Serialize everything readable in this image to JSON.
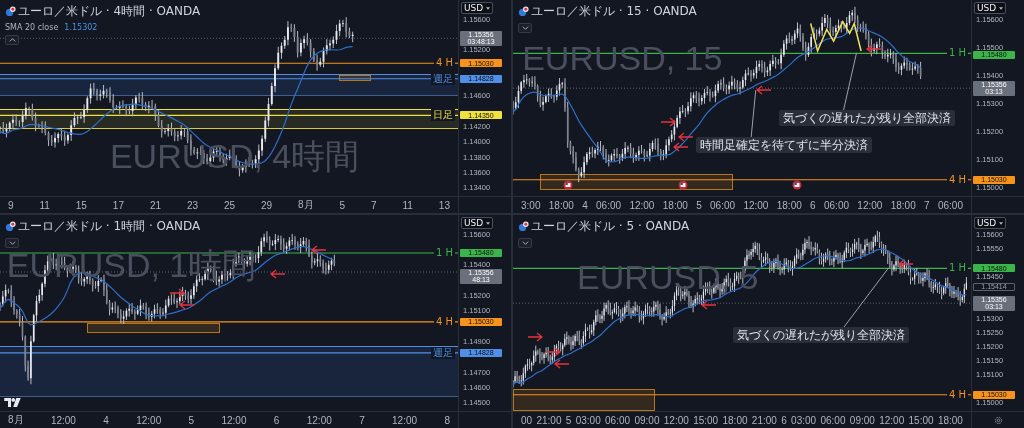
{
  "panels": [
    {
      "title": "ユーロ／米ドル · 4時間 · OANDA",
      "currency": "USD",
      "legend_expanded": true,
      "legend": {
        "name": "SMA 20 close",
        "value": "1.15302"
      },
      "watermark": "EURUSD, 4時間",
      "price_ticks": [
        "1.15600",
        "1.15200",
        "1.14600",
        "1.14200",
        "1.14000",
        "1.13800",
        "1.13600",
        "1.13400"
      ],
      "levels": [
        {
          "kind": "last",
          "price": "1.15356",
          "countdown": "03:48:13"
        },
        {
          "kind": "level",
          "label": "4 H",
          "price": "1.15030",
          "color": "#f7931a"
        },
        {
          "kind": "level",
          "label": "週足",
          "price": "1.14828",
          "color": "#4f8fe8"
        },
        {
          "kind": "level",
          "label": "日足",
          "price": "1.14350",
          "color": "#f0e040"
        }
      ],
      "time_ticks": [
        "9",
        "11",
        "15",
        "17",
        "21",
        "23",
        "25",
        "29",
        "8月",
        "5",
        "7",
        "11",
        "13"
      ]
    },
    {
      "title": "ユーロ／米ドル · 15 · OANDA",
      "currency": "USD",
      "legend_expanded": false,
      "watermark": "EURUSD, 15",
      "price_ticks": [
        "1.15600",
        "1.15500",
        "1.15400",
        "1.15300",
        "1.15200",
        "1.15100",
        "1.15000"
      ],
      "levels": [
        {
          "kind": "level",
          "label": "1 H",
          "price": "1.15480",
          "color": "#3bb54a"
        },
        {
          "kind": "last",
          "price": "1.15356",
          "countdown": "03:13"
        },
        {
          "kind": "level",
          "label": "4 H",
          "price": "1.15030",
          "color": "#f7931a"
        }
      ],
      "callouts": [
        "時間足確定を待てずに半分決済",
        "気づくの遅れたが残り全部決済"
      ],
      "time_ticks": [
        "3:00",
        "18:00",
        "4",
        "06:00",
        "12:00",
        "18:00",
        "5",
        "06:00",
        "12:00",
        "18:00",
        "6",
        "06:00",
        "12:00",
        "18:00",
        "7",
        "06:00"
      ]
    },
    {
      "title": "ユーロ／米ドル · 1時間 · OANDA",
      "currency": "USD",
      "legend_expanded": false,
      "watermark": "EURUSD, 1時間",
      "logo": true,
      "price_ticks": [
        "1.15600",
        "1.15400",
        "1.15200",
        "1.15100",
        "1.14900",
        "1.14700",
        "1.14600",
        "1.14500"
      ],
      "levels": [
        {
          "kind": "level",
          "label": "1 H",
          "price": "1.15480",
          "color": "#3bb54a"
        },
        {
          "kind": "last",
          "price": "1.15356",
          "countdown": "48:13"
        },
        {
          "kind": "level",
          "label": "4 H",
          "price": "1.15030",
          "color": "#f7931a"
        },
        {
          "kind": "level",
          "label": "週足",
          "price": "1.14828",
          "color": "#4f8fe8"
        }
      ],
      "time_ticks": [
        "8月",
        "12:00",
        "4",
        "12:00",
        "5",
        "12:00",
        "6",
        "12:00",
        "7",
        "12:00",
        "8"
      ]
    },
    {
      "title": "ユーロ／米ドル · 5 · OANDA",
      "currency": "USD",
      "legend_expanded": false,
      "watermark": "EURUSD, 5",
      "settings_icon": true,
      "price_ticks": [
        "1.15600",
        "1.15550",
        "1.15450",
        "1.15300",
        "1.15250",
        "1.15200",
        "1.15150",
        "1.15100",
        "1.15000"
      ],
      "levels": [
        {
          "kind": "level",
          "label": "1 H",
          "price": "1.15480",
          "color": "#3bb54a"
        },
        {
          "kind": "marker",
          "price": "1.15414"
        },
        {
          "kind": "last",
          "price": "1.15356",
          "countdown": "03:13"
        },
        {
          "kind": "level",
          "label": "4 H",
          "price": "1.15030",
          "color": "#f7931a"
        }
      ],
      "callouts": [
        "気づくの遅れたが残り全部決済"
      ],
      "time_ticks": [
        "00",
        "21:00",
        "5",
        "03:00",
        "06:00",
        "09:00",
        "12:00",
        "15:00",
        "18:00",
        "21:00",
        "6",
        "03:00",
        "06:00",
        "09:00",
        "12:00",
        "15:00",
        "18:00"
      ]
    }
  ]
}
